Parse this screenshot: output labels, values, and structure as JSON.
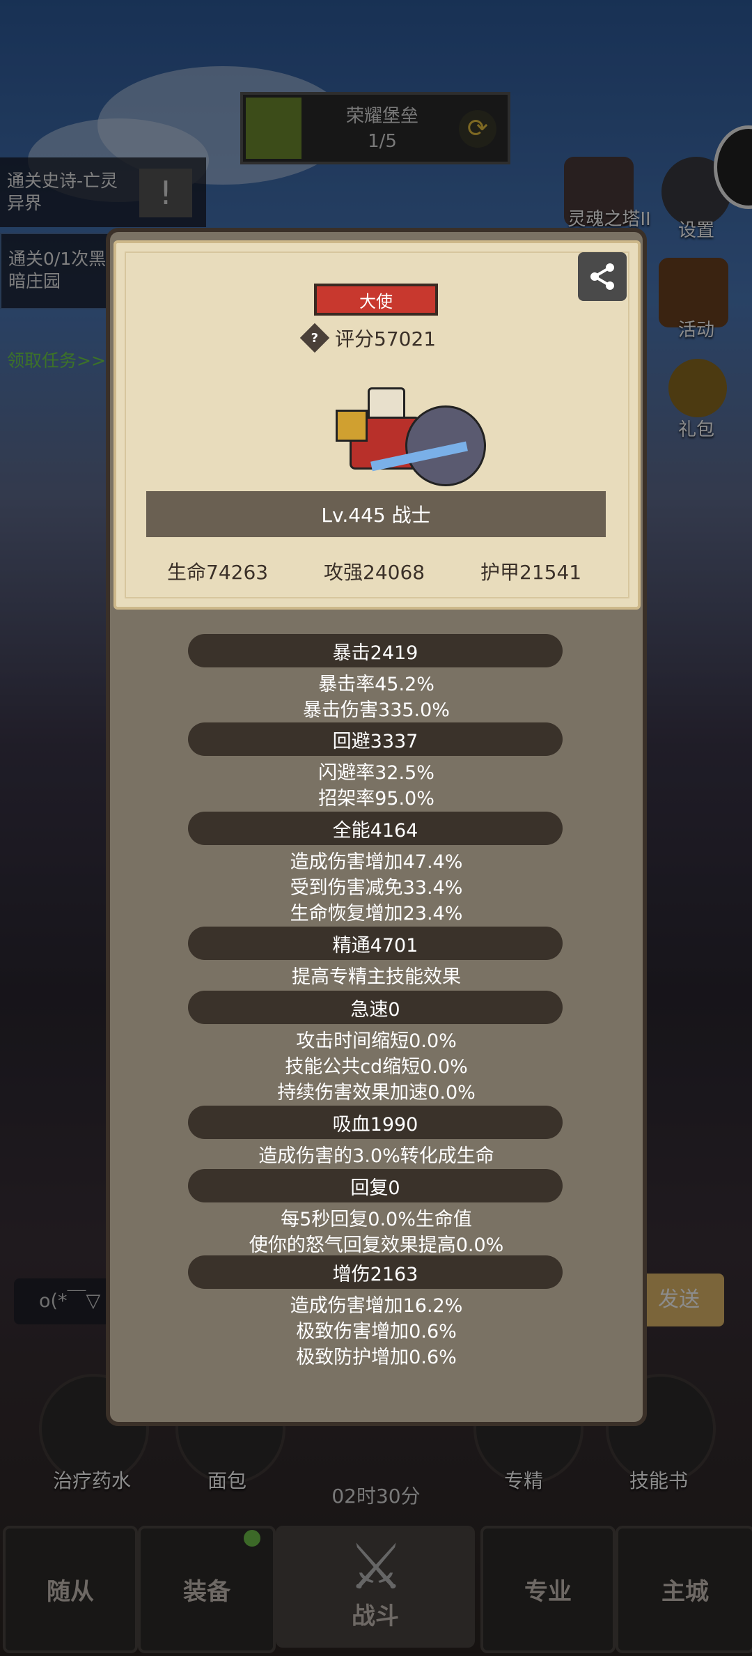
{
  "tower": {
    "name": "荣耀堡垒",
    "progress": "1/5"
  },
  "left_tasks": [
    {
      "text": "通关史诗-亡灵异界"
    },
    {
      "text": "通关0/1次黑暗庄园"
    },
    {
      "text": "领取任务>>"
    }
  ],
  "right_menu": [
    {
      "label": "灵魂之塔II"
    },
    {
      "label": "设置"
    },
    {
      "label": "活动"
    },
    {
      "label": "礼包"
    }
  ],
  "chat": {
    "placeholder": "o(*￣▽",
    "send_label": "发送"
  },
  "bottom_actions": [
    {
      "label": "治疗药水"
    },
    {
      "label": "面包"
    },
    {
      "label": "专精"
    },
    {
      "label": "技能书"
    }
  ],
  "timer": "02时30分",
  "nav": {
    "followers": "随从",
    "equipment": "装备",
    "battle": "战斗",
    "profession": "专业",
    "main_city": "主城"
  },
  "profile": {
    "title": "大使",
    "score": "评分57021",
    "level_class": "Lv.445 战士",
    "hp": "生命74263",
    "attack": "攻强24068",
    "armor": "护甲21541"
  },
  "stats": [
    {
      "header": "暴击2419",
      "lines": [
        "暴击率45.2%",
        "暴击伤害335.0%"
      ]
    },
    {
      "header": "回避3337",
      "lines": [
        "闪避率32.5%",
        "招架率95.0%"
      ]
    },
    {
      "header": "全能4164",
      "lines": [
        "造成伤害增加47.4%",
        "受到伤害减免33.4%",
        "生命恢复增加23.4%"
      ]
    },
    {
      "header": "精通4701",
      "lines": [
        "提高专精主技能效果"
      ]
    },
    {
      "header": "急速0",
      "lines": [
        "攻击时间缩短0.0%",
        "技能公共cd缩短0.0%",
        "持续伤害效果加速0.0%"
      ]
    },
    {
      "header": "吸血1990",
      "lines": [
        "造成伤害的3.0%转化成生命"
      ]
    },
    {
      "header": "回复0",
      "lines": [
        "每5秒回复0.0%生命值",
        "使你的怒气回复效果提高0.0%"
      ]
    },
    {
      "header": "增伤2163",
      "lines": [
        "造成伤害增加16.2%",
        "极致伤害增加0.6%",
        "极致防护增加0.6%"
      ]
    }
  ],
  "colors": {
    "badge_red": "#c8382e",
    "card": "#e8dcbc",
    "panel": "#7a7264",
    "header": "#3a322a"
  }
}
